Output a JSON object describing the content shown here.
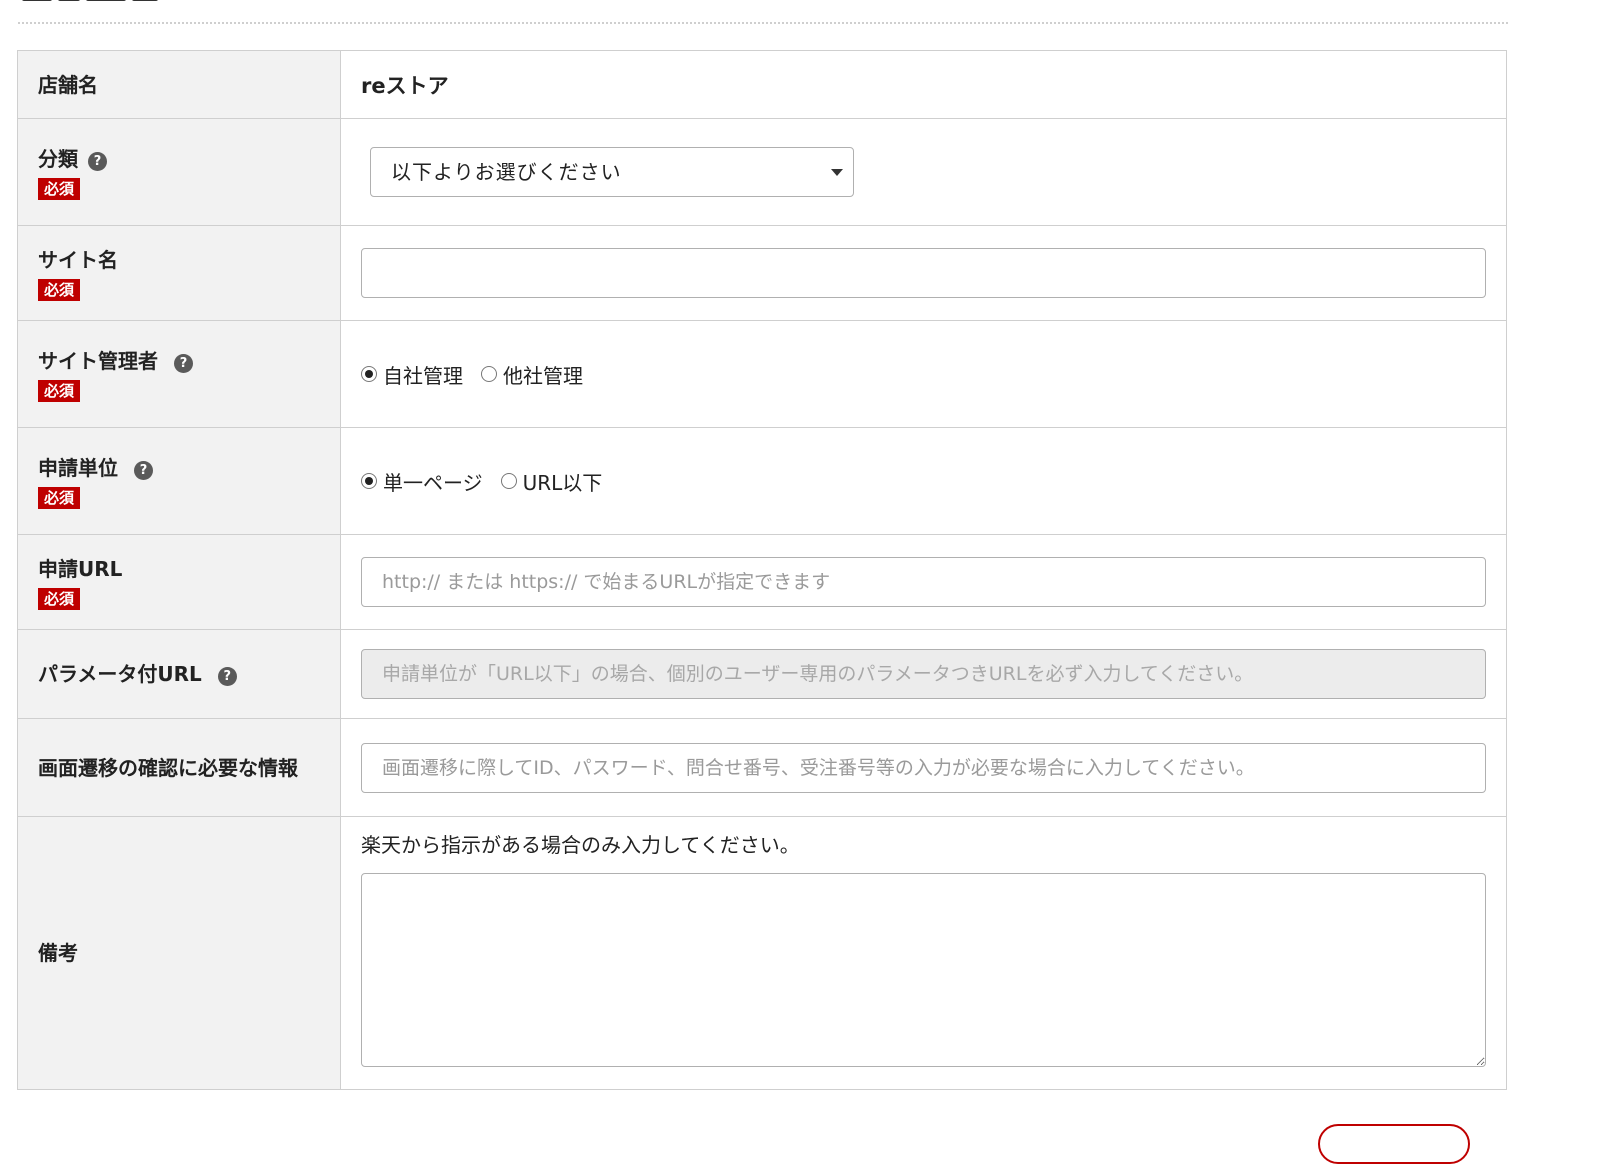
{
  "form": {
    "store_name": {
      "label": "店舗名",
      "value": "reストア"
    },
    "category": {
      "label": "分類",
      "required_badge": "必須",
      "help_icon": "?",
      "select_value": "以下よりお選びください"
    },
    "site_name": {
      "label": "サイト名",
      "required_badge": "必須",
      "value": ""
    },
    "site_admin": {
      "label": "サイト管理者",
      "required_badge": "必須",
      "help_icon": "?",
      "options": [
        {
          "label": "自社管理",
          "checked": true
        },
        {
          "label": "他社管理",
          "checked": false
        }
      ]
    },
    "application_unit": {
      "label": "申請単位",
      "required_badge": "必須",
      "help_icon": "?",
      "options": [
        {
          "label": "単一ページ",
          "checked": true
        },
        {
          "label": "URL以下",
          "checked": false
        }
      ]
    },
    "application_url": {
      "label": "申請URL",
      "required_badge": "必須",
      "placeholder": "http:// または https:// で始まるURLが指定できます"
    },
    "param_url": {
      "label": "パラメータ付URL",
      "help_icon": "?",
      "placeholder": "申請単位が「URL以下」の場合、個別のユーザー専用のパラメータつきURLを必ず入力してください。"
    },
    "transition_info": {
      "label": "画面遷移の確認に必要な情報",
      "placeholder": "画面遷移に際してID、パスワード、問合せ番号、受注番号等の入力が必要な場合に入力してください。"
    },
    "remarks": {
      "label": "備考",
      "note": "楽天から指示がある場合のみ入力してください。",
      "value": ""
    }
  },
  "colors": {
    "required_badge": "#bf0000",
    "label_bg": "#f2f2f2",
    "border": "#cfcfcf",
    "disabled_bg": "#ececec"
  }
}
